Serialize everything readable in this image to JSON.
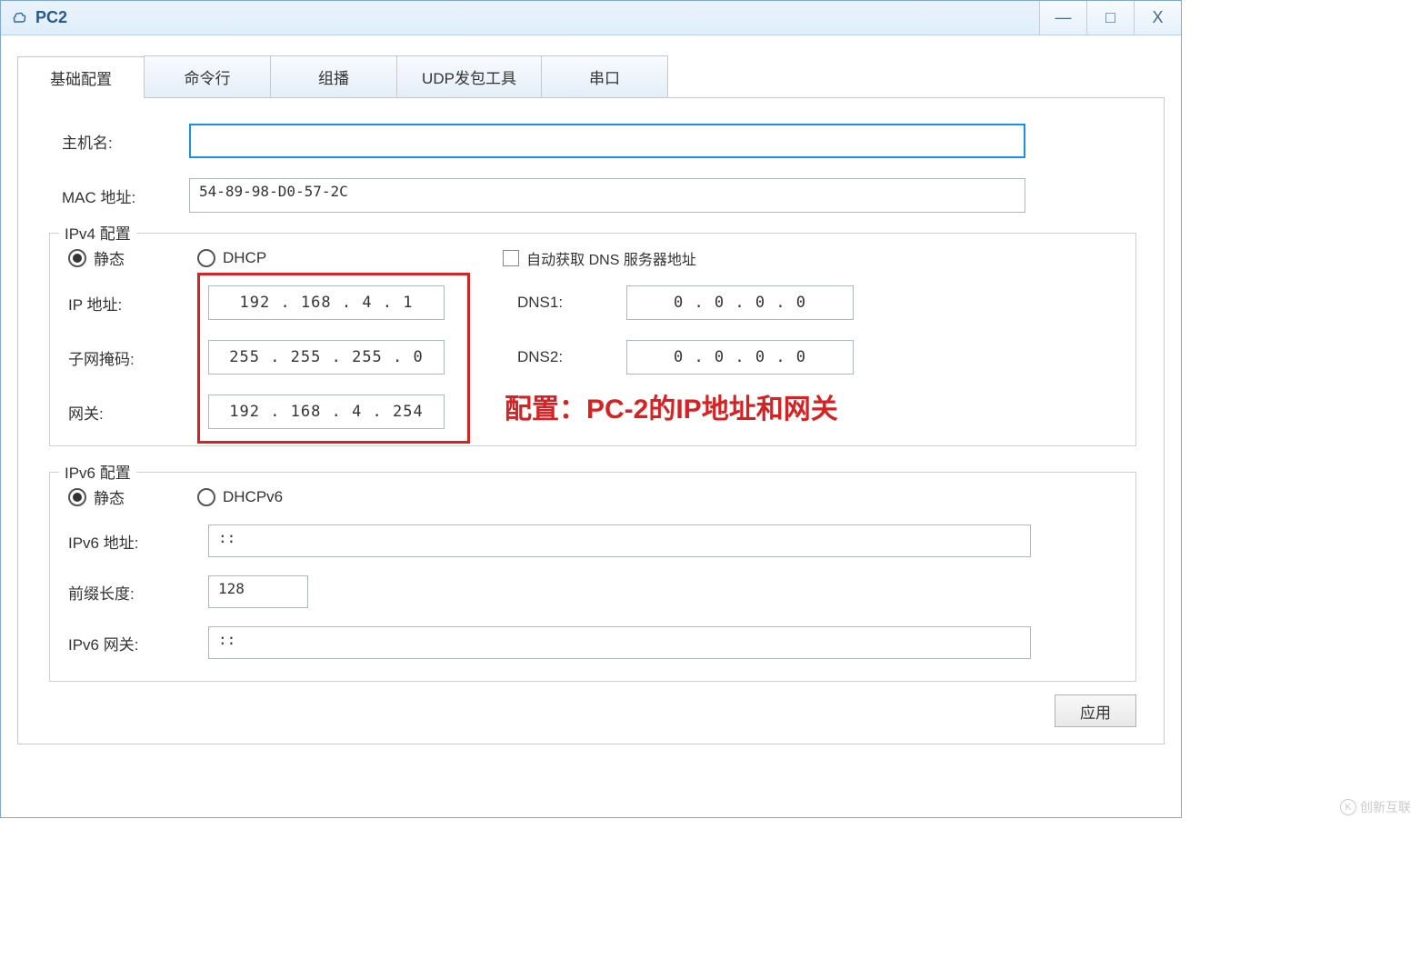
{
  "window": {
    "title": "PC2",
    "controls": {
      "min": "—",
      "max": "□",
      "close": "X"
    }
  },
  "tabs": [
    {
      "label": "基础配置",
      "active": true
    },
    {
      "label": "命令行",
      "active": false
    },
    {
      "label": "组播",
      "active": false
    },
    {
      "label": "UDP发包工具",
      "active": false
    },
    {
      "label": "串口",
      "active": false
    }
  ],
  "basic": {
    "hostname_label": "主机名:",
    "hostname_value": "",
    "mac_label": "MAC 地址:",
    "mac_value": "54-89-98-D0-57-2C"
  },
  "ipv4": {
    "legend": "IPv4 配置",
    "radio_static": "静态",
    "radio_dhcp": "DHCP",
    "auto_dns_label": "自动获取 DNS 服务器地址",
    "ip_label": "IP 地址:",
    "ip_value": "192 . 168 .  4  .  1",
    "mask_label": "子网掩码:",
    "mask_value": "255 . 255 . 255 .  0",
    "gw_label": "网关:",
    "gw_value": "192 . 168 .  4  . 254",
    "dns1_label": "DNS1:",
    "dns1_value": "0  .  0  .  0  .  0",
    "dns2_label": "DNS2:",
    "dns2_value": "0  .  0  .  0  .  0"
  },
  "ipv6": {
    "legend": "IPv6 配置",
    "radio_static": "静态",
    "radio_dhcpv6": "DHCPv6",
    "addr_label": "IPv6 地址:",
    "addr_value": "::",
    "prefix_label": "前缀长度:",
    "prefix_value": "128",
    "gw_label": "IPv6 网关:",
    "gw_value": "::"
  },
  "buttons": {
    "apply": "应用"
  },
  "annotation": "配置：PC-2的IP地址和网关",
  "watermark": "创新互联"
}
